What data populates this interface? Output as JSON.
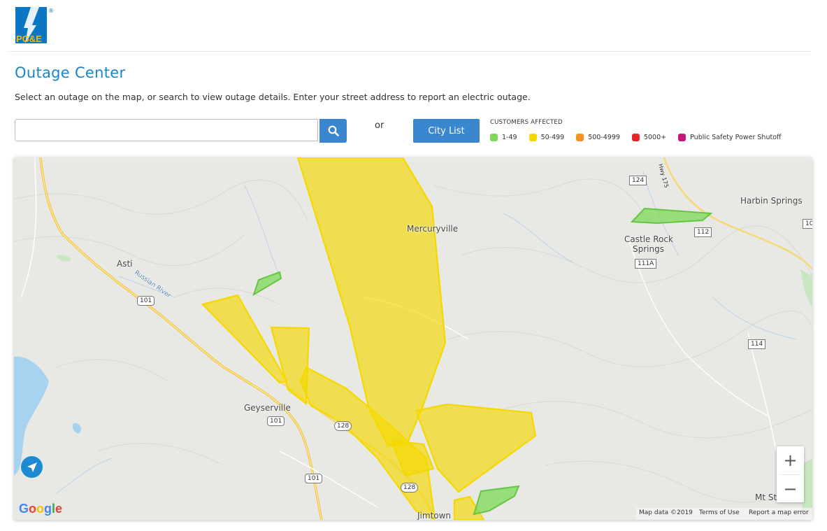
{
  "header": {
    "logo_text": "PG&E",
    "registered_mark": "®"
  },
  "page": {
    "title": "Outage Center",
    "subtitle": "Select an outage on the map, or search to view outage details. Enter your street address to report an electric outage."
  },
  "search": {
    "value": "",
    "placeholder": "",
    "button_icon": "search-icon"
  },
  "or_label": "or",
  "city_list_button": "City List",
  "legend": {
    "title": "CUSTOMERS AFFECTED",
    "items": [
      {
        "label": "1-49",
        "color": "#7ed957"
      },
      {
        "label": "50-499",
        "color": "#f5d800"
      },
      {
        "label": "500-4999",
        "color": "#f5921e"
      },
      {
        "label": "5000+",
        "color": "#e8262a"
      },
      {
        "label": "Public Safety Power Shutoff",
        "color": "#c8157a"
      }
    ]
  },
  "map": {
    "places": [
      "Mercuryville",
      "Harbin Springs",
      "Castle Rock",
      "Springs",
      "Asti",
      "Russian River",
      "Geyserville",
      "Jimtown",
      "Mt St"
    ],
    "shields": [
      "124",
      "Hwy 175",
      "112",
      "111A",
      "114",
      "101",
      "101",
      "101",
      "128",
      "128",
      "10"
    ],
    "zoom_in": "+",
    "zoom_out": "−",
    "attribution": {
      "logo": "Google",
      "map_data": "Map data ©2019",
      "terms": "Terms of Use",
      "report": "Report a map error"
    },
    "outage_colors": {
      "low": "#7ed957",
      "medium": "#f5d800"
    }
  }
}
